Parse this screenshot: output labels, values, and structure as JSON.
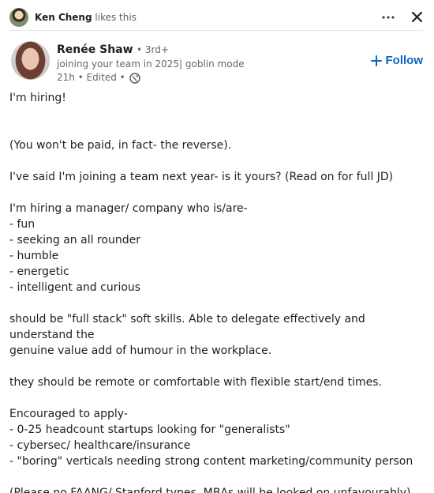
{
  "social": {
    "actor": "Ken Cheng",
    "action": "likes this"
  },
  "author": {
    "name": "Renée Shaw",
    "degree": "• 3rd+",
    "headline": "joining your team in 2025| goblin mode",
    "meta": "21h • Edited •",
    "follow_label": "Follow"
  },
  "post": {
    "lines": [
      "I'm hiring!",
      "",
      "",
      "(You won't be paid, in fact- the reverse).",
      "",
      "I've said I'm joining a team next year- is it yours? (Read on for full JD)",
      "",
      "I'm hiring a manager/ company who is/are-",
      "- fun",
      "- seeking an all rounder",
      "- humble",
      "- energetic",
      "- intelligent and curious",
      "",
      "should be \"full stack\" soft skills. Able to delegate effectively and understand the",
      "genuine value add of humour in the workplace.",
      "",
      "they should be remote or comfortable with flexible start/end times.",
      "",
      "Encouraged to apply-",
      "- 0-25 headcount startups looking for \"generalists\"",
      "- cybersec/ healthcare/insurance",
      "- \"boring\" verticals needing strong content marketing/community person",
      "",
      "(Please no FAANG/ Stanford types. MBAs will be looked on unfavourably)"
    ]
  },
  "colors": {
    "accent": "#0a66c2",
    "text": "#1f1f1f",
    "muted": "#666666"
  },
  "icons": {
    "more": "more-horizontal-icon",
    "close": "close-icon",
    "globe": "globe-icon",
    "plus": "plus-icon"
  }
}
